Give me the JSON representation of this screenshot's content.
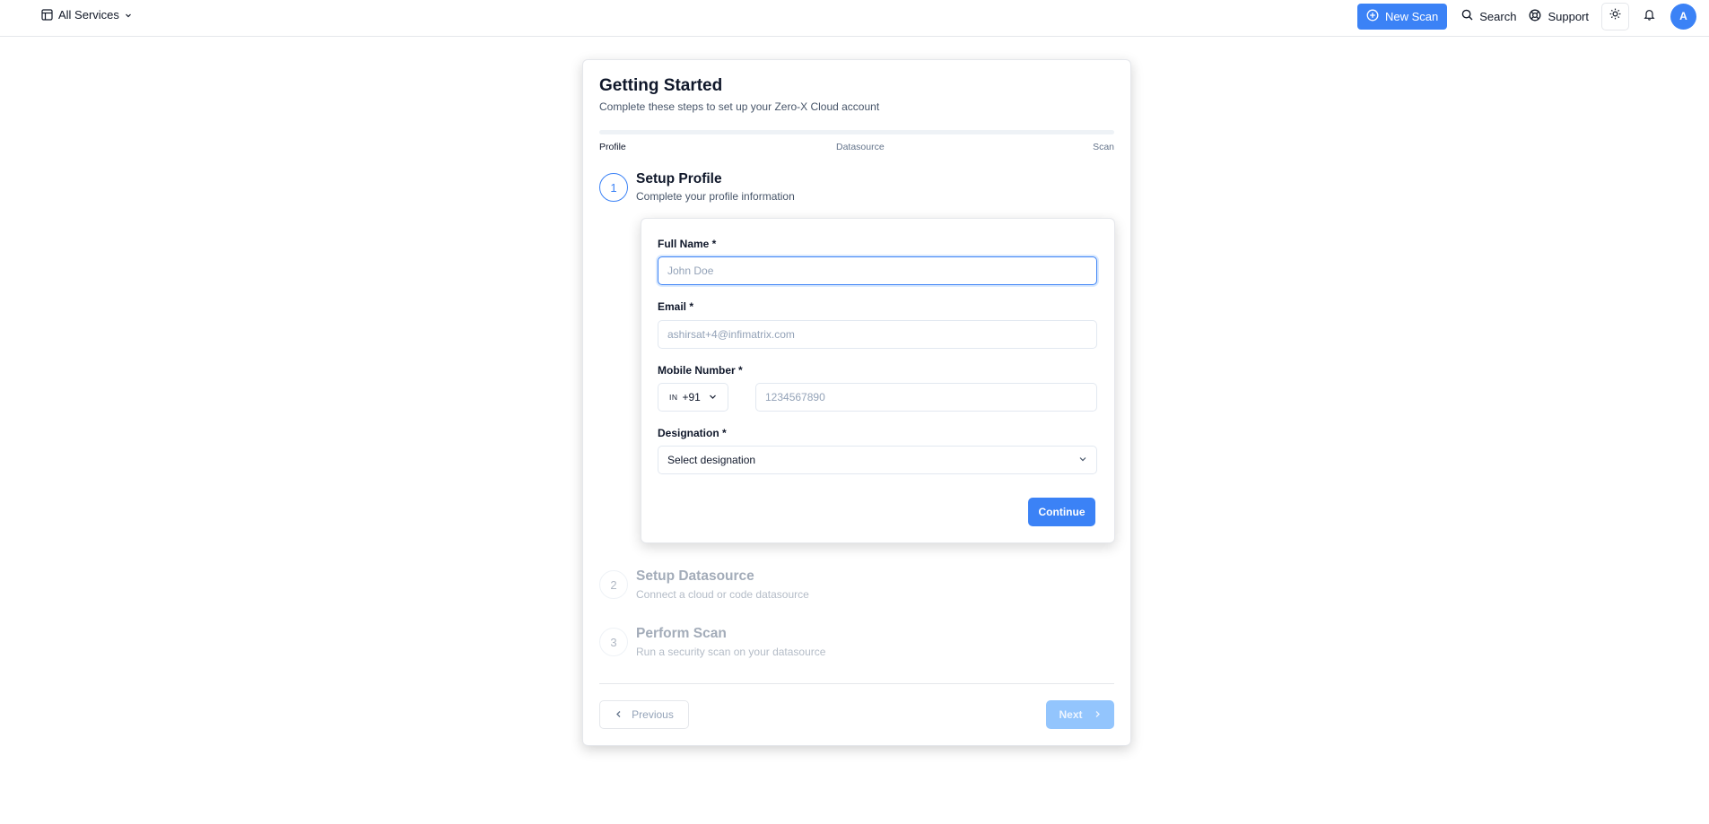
{
  "header": {
    "services_label": "All Services",
    "new_scan_label": "New Scan",
    "search_label": "Search",
    "support_label": "Support",
    "avatar_initial": "A"
  },
  "card": {
    "title": "Getting Started",
    "subtitle": "Complete these steps to set up your Zero-X Cloud account",
    "progress_percent": 0,
    "progress_steps": [
      "Profile",
      "Datasource",
      "Scan"
    ]
  },
  "steps": [
    {
      "number": "1",
      "title": "Setup Profile",
      "description": "Complete your profile information"
    },
    {
      "number": "2",
      "title": "Setup Datasource",
      "description": "Connect a cloud or code datasource"
    },
    {
      "number": "3",
      "title": "Perform Scan",
      "description": "Run a security scan on your datasource"
    }
  ],
  "form": {
    "full_name_label": "Full Name *",
    "full_name_placeholder": "John Doe",
    "email_label": "Email *",
    "email_value": "ashirsat+4@infimatrix.com",
    "mobile_label": "Mobile Number *",
    "country_flag": "IN",
    "country_code": "+91",
    "phone_placeholder": "1234567890",
    "designation_label": "Designation *",
    "designation_value": "Select designation",
    "continue_label": "Continue"
  },
  "footer": {
    "previous_label": "Previous",
    "next_label": "Next"
  }
}
